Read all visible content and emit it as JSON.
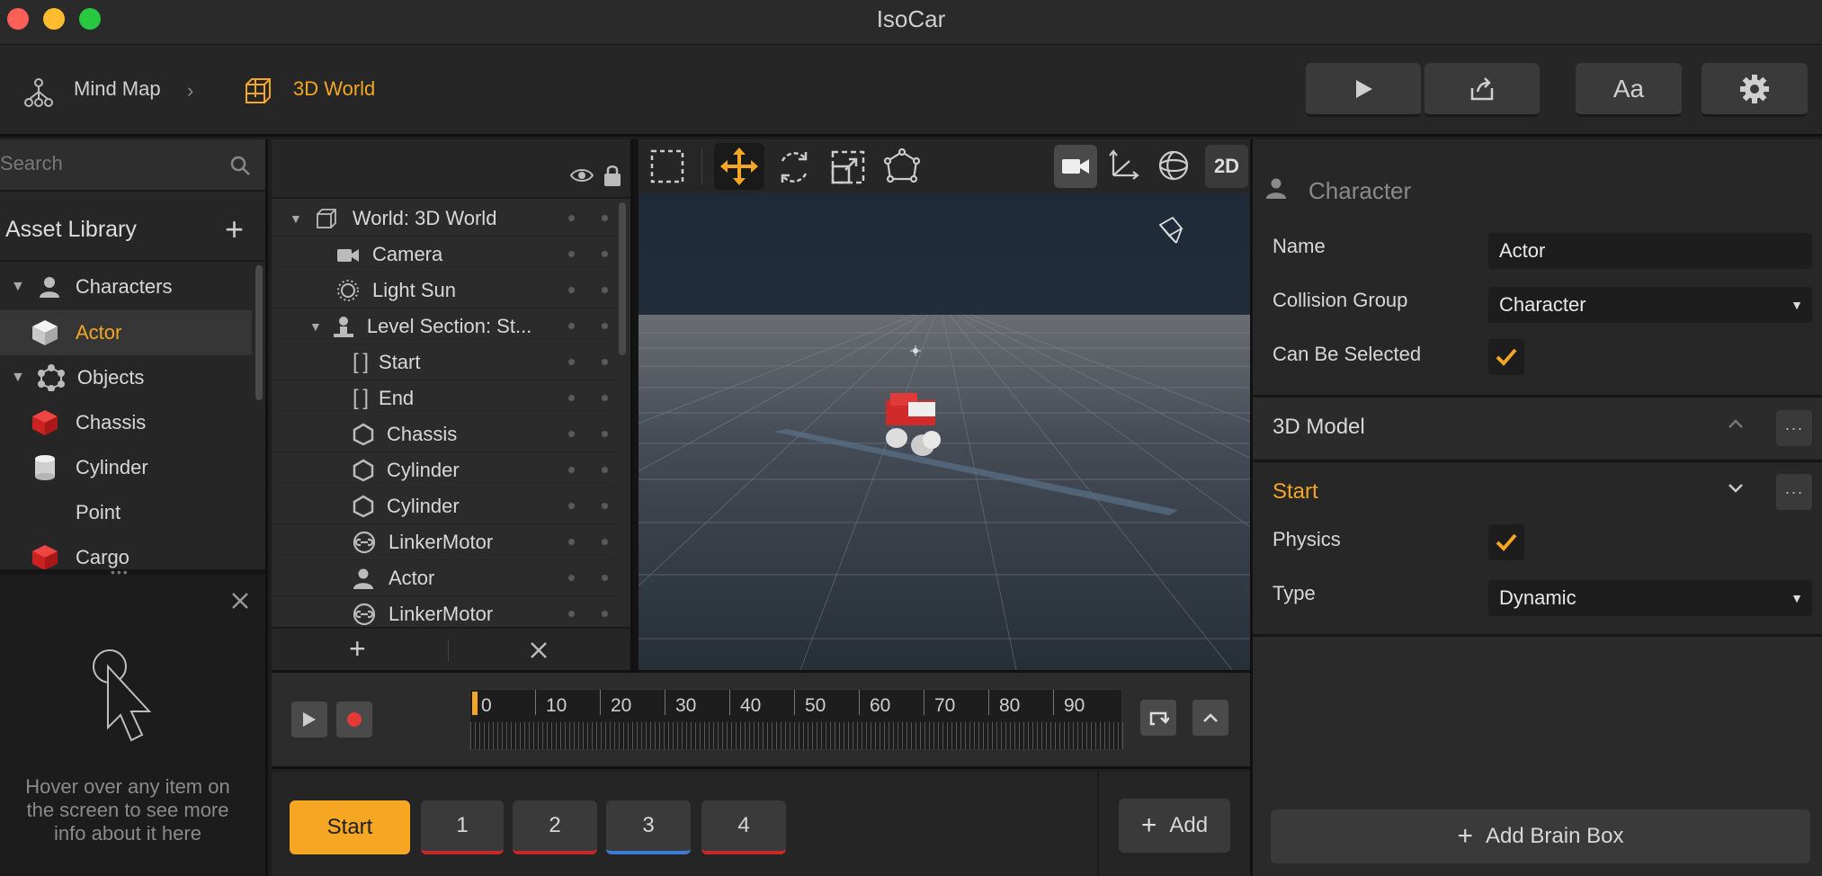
{
  "app": {
    "title": "IsoCar"
  },
  "breadcrumb": {
    "mind_map": "Mind Map",
    "world": "3D World"
  },
  "colors": {
    "accent": "#f5a623",
    "window_close": "#fe5f57",
    "window_min": "#febc2e",
    "window_max": "#28c840"
  },
  "search": {
    "placeholder": "Search"
  },
  "library": {
    "title": "Asset Library",
    "items": [
      {
        "label": "Characters",
        "kind": "category"
      },
      {
        "label": "Actor",
        "kind": "asset",
        "selected": true
      },
      {
        "label": "Objects",
        "kind": "category"
      },
      {
        "label": "Chassis",
        "kind": "asset"
      },
      {
        "label": "Cylinder",
        "kind": "asset"
      },
      {
        "label": "Point",
        "kind": "asset"
      },
      {
        "label": "Cargo",
        "kind": "asset"
      }
    ]
  },
  "help": {
    "text": "Hover over any item on the screen to see more info about it here"
  },
  "hierarchy": {
    "items": [
      {
        "label": "World: 3D World",
        "icon": "cube-icon"
      },
      {
        "label": "Camera",
        "icon": "camera-icon"
      },
      {
        "label": "Light Sun",
        "icon": "sun-icon"
      },
      {
        "label": "Level Section: St...",
        "icon": "level-icon"
      },
      {
        "label": "Start",
        "icon": "bracket-icon"
      },
      {
        "label": "End",
        "icon": "bracket-icon"
      },
      {
        "label": "Chassis",
        "icon": "hexagon-icon"
      },
      {
        "label": "Cylinder",
        "icon": "hexagon-icon"
      },
      {
        "label": "Cylinder",
        "icon": "hexagon-icon"
      },
      {
        "label": "LinkerMotor",
        "icon": "link-icon"
      },
      {
        "label": "Actor",
        "icon": "person-icon"
      },
      {
        "label": "LinkerMotor",
        "icon": "link-icon"
      }
    ]
  },
  "viewport": {
    "mode_2d": "2D"
  },
  "timeline": {
    "ticks": [
      "0",
      "10",
      "20",
      "30",
      "40",
      "50",
      "60",
      "70",
      "80",
      "90"
    ]
  },
  "tabs": {
    "start": "Start",
    "items": [
      "1",
      "2",
      "3",
      "4"
    ],
    "add": "Add"
  },
  "inspector": {
    "header": "Character",
    "name_label": "Name",
    "name_value": "Actor",
    "collision_label": "Collision Group",
    "collision_value": "Character",
    "selectable_label": "Can Be Selected",
    "model_section": "3D Model",
    "start_section": "Start",
    "physics_label": "Physics",
    "type_label": "Type",
    "type_value": "Dynamic",
    "add_brain": "Add Brain Box"
  }
}
